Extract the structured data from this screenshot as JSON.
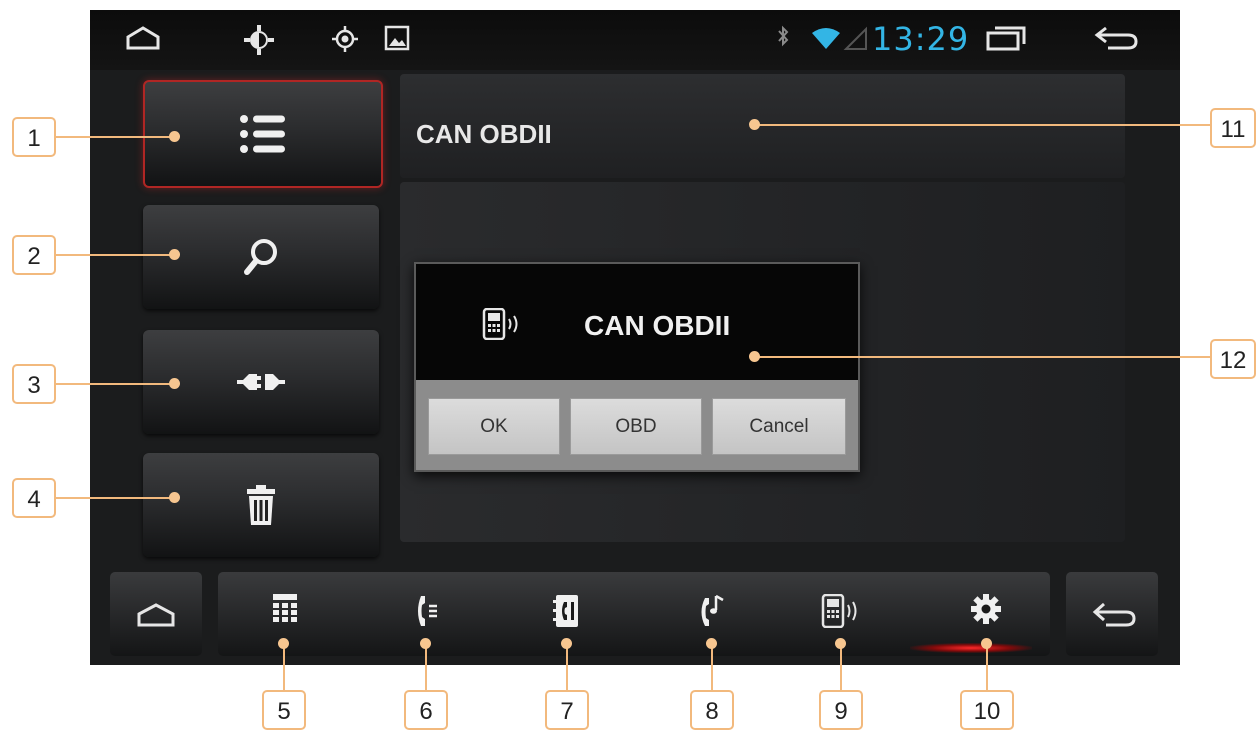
{
  "status_bar": {
    "time": "13:29",
    "icons": [
      "home-outline-icon",
      "brightness-icon",
      "gps-icon",
      "gallery-icon",
      "bluetooth-icon",
      "wifi-icon",
      "recent-apps-icon",
      "back-arrow-icon"
    ]
  },
  "sidebar": {
    "items": [
      {
        "icon": "list-icon",
        "active": true
      },
      {
        "icon": "search-icon"
      },
      {
        "icon": "connect-plug-icon"
      },
      {
        "icon": "trash-icon"
      }
    ]
  },
  "main": {
    "title": "CAN OBDII"
  },
  "dialog": {
    "icon": "bluetooth-phone-icon",
    "title": "CAN OBDII",
    "buttons": [
      "OK",
      "OBD",
      "Cancel"
    ]
  },
  "bottom_bar": {
    "home_icon": "home-outline-icon",
    "back_icon": "back-arrow-icon",
    "dock_items": [
      "dialpad-icon",
      "call-log-icon",
      "contacts-icon",
      "music-call-icon",
      "bluetooth-device-icon",
      "settings-gear-icon"
    ],
    "active_index": 4
  },
  "callouts": [
    "1",
    "2",
    "3",
    "4",
    "5",
    "6",
    "7",
    "8",
    "9",
    "10",
    "11",
    "12"
  ],
  "colors": {
    "accent_blue": "#33b5e5",
    "active_red": "#d22a2a",
    "callout_orange": "#f2b97d"
  }
}
